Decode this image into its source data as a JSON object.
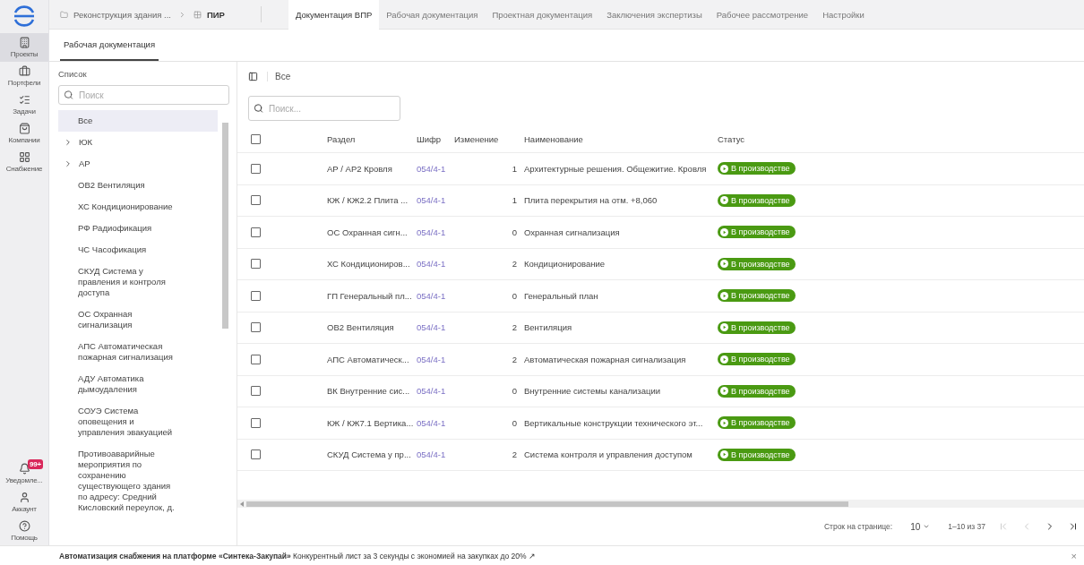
{
  "rail": {
    "items": [
      {
        "label": "Проекты",
        "selected": true
      },
      {
        "label": "Портфели",
        "selected": false
      },
      {
        "label": "Задачи",
        "selected": false
      },
      {
        "label": "Компании",
        "selected": false
      },
      {
        "label": "Снабжение",
        "selected": false
      }
    ],
    "bottom": [
      {
        "label": "Уведомле...",
        "badge": "99+"
      },
      {
        "label": "Аккаунт"
      },
      {
        "label": "Помощь"
      }
    ]
  },
  "breadcrumb": [
    {
      "label": "Реконструкция здания ...",
      "current": false
    },
    {
      "label": "ПИР",
      "current": true
    }
  ],
  "tabs": [
    {
      "label": "Документация ВПР",
      "selected": true
    },
    {
      "label": "Рабочая документация",
      "selected": false
    },
    {
      "label": "Проектная документация",
      "selected": false
    },
    {
      "label": "Заключения экспертизы",
      "selected": false
    },
    {
      "label": "Рабочее рассмотрение",
      "selected": false
    },
    {
      "label": "Настройки",
      "selected": false
    }
  ],
  "subtabs": [
    {
      "label": "Рабочая документация",
      "selected": true
    }
  ],
  "list": {
    "title": "Список",
    "search_placeholder": "Поиск",
    "items": [
      {
        "label": "Все",
        "kind": "item",
        "selected": true
      },
      {
        "label": "ЮК",
        "kind": "group",
        "selected": false
      },
      {
        "label": "АР",
        "kind": "group",
        "selected": false
      },
      {
        "label": "ОВ2 Вентиляция",
        "kind": "item",
        "selected": false
      },
      {
        "label": "ХС Кондиционирование",
        "kind": "item",
        "selected": false
      },
      {
        "label": "РФ Радиофикация",
        "kind": "item",
        "selected": false
      },
      {
        "label": "ЧС Часофикация",
        "kind": "item",
        "selected": false
      },
      {
        "label": "СКУД Система у правления и контроля доступа",
        "kind": "item",
        "selected": false
      },
      {
        "label": "ОС Охранная сигнализация",
        "kind": "item",
        "selected": false
      },
      {
        "label": "АПС Автоматическая пожарная сигнализация",
        "kind": "item",
        "selected": false
      },
      {
        "label": "АДУ Автоматика дымоудаления",
        "kind": "item",
        "selected": false
      },
      {
        "label": "СОУЭ Система оповещения и управления эвакуацией",
        "kind": "item",
        "selected": false
      },
      {
        "label": "Противоаварийные мероприятия по сохранению существующего здания по адресу: Средний Кисловский переулок, д.",
        "kind": "item",
        "selected": false
      }
    ]
  },
  "table": {
    "view_title": "Все",
    "search_placeholder": "Поиск...",
    "header_checked": false,
    "columns": [
      "Раздел",
      "Шифр",
      "Изменение",
      "Наименование",
      "Статус"
    ],
    "rows": [
      {
        "checked": false,
        "section": "АР / АР2 Кровля",
        "code": "054/4-1",
        "change": "1",
        "name": "Архитектурные решения. Общежитие. Кровля",
        "status": "В производстве"
      },
      {
        "checked": false,
        "section": "КЖ / КЖ2.2 Плита ...",
        "code": "054/4-1",
        "change": "1",
        "name": "Плита перекрытия на отм. +8,060",
        "status": "В производстве"
      },
      {
        "checked": false,
        "section": "ОС Охранная сигн...",
        "code": "054/4-1",
        "change": "0",
        "name": "Охранная сигнализация",
        "status": "В производстве"
      },
      {
        "checked": false,
        "section": "ХС Кондициониров...",
        "code": "054/4-1",
        "change": "2",
        "name": "Кондиционирование",
        "status": "В производстве"
      },
      {
        "checked": false,
        "section": "ГП Генеральный пл...",
        "code": "054/4-1",
        "change": "0",
        "name": "Генеральный план",
        "status": "В производстве"
      },
      {
        "checked": false,
        "section": "ОВ2 Вентиляция",
        "code": "054/4-1",
        "change": "2",
        "name": "Вентиляция",
        "status": "В производстве"
      },
      {
        "checked": false,
        "section": "АПС Автоматическ...",
        "code": "054/4-1",
        "change": "2",
        "name": "Автоматическая пожарная сигнализация",
        "status": "В производстве"
      },
      {
        "checked": false,
        "section": "ВК Внутренние сис...",
        "code": "054/4-1",
        "change": "0",
        "name": "Внутренние системы канализации",
        "status": "В производстве"
      },
      {
        "checked": false,
        "section": "КЖ / КЖ7.1 Вертика...",
        "code": "054/4-1",
        "change": "0",
        "name": "Вертикальные конструкции технического эт...",
        "status": "В производстве"
      },
      {
        "checked": false,
        "section": "СКУД Система у пр...",
        "code": "054/4-1",
        "change": "2",
        "name": "Система контроля и управления доступом",
        "status": "В производстве"
      }
    ]
  },
  "pagination": {
    "rows_label": "Строк на странице:",
    "rows_value": "10",
    "range": "1–10 из 37",
    "buttons": [
      {
        "disabled": true
      },
      {
        "disabled": true
      },
      {
        "disabled": false
      },
      {
        "disabled": false
      }
    ]
  },
  "banner": {
    "text": "**Автоматизация снабжения на платформе «Синтека-Закупай»** Конкурентный лист за 3 секунды с экономией на закупках до 20% ↗",
    "close": "×"
  }
}
